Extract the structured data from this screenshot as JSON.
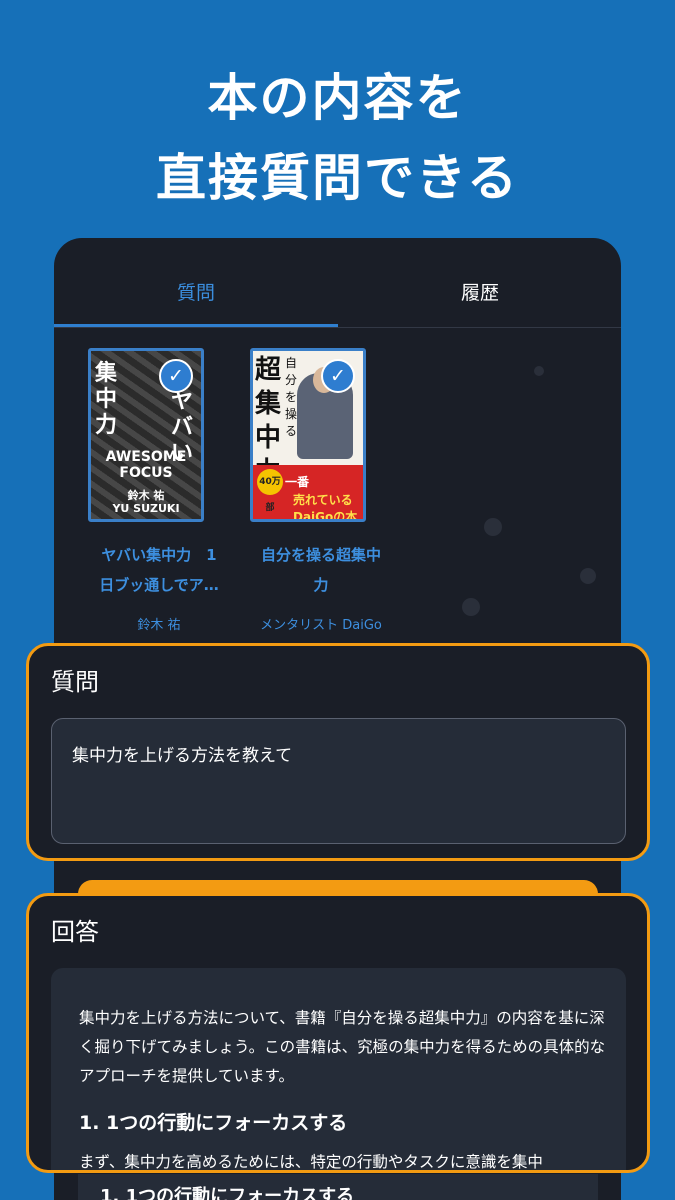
{
  "headline": {
    "line1": "本の内容を",
    "line2": "直接質問できる"
  },
  "tabs": {
    "question": "質問",
    "history": "履歴"
  },
  "books": [
    {
      "title_line1": "ヤバい集中力　1",
      "title_line2": "日ブッ通しでア…",
      "author": "鈴木 祐",
      "cover": {
        "kanji": "集中力",
        "kanji2": "ヤバい",
        "en_line1": "AWESOME",
        "en_line2": "FOCUS",
        "author_jp": "鈴木 祐",
        "author_en": "YU SUZUKI"
      }
    },
    {
      "title_line1": "自分を操る超集中",
      "title_line2": "力",
      "author": "メンタリスト DaiGo",
      "cover": {
        "big": "超集中力",
        "small": "自分を操る",
        "seal": "40万部",
        "band1": "一番",
        "band2": "売れている DaiGoの本"
      }
    }
  ],
  "question": {
    "label": "質問",
    "text": "集中力を上げる方法を教えて"
  },
  "answer": {
    "label": "回答",
    "body": "集中力を上げる方法について、書籍『自分を操る超集中力』の内容を基に深く掘り下げてみましょう。この書籍は、究極の集中力を得るための具体的なアプローチを提供しています。",
    "heading": "1. 1つの行動にフォーカスする",
    "para2": "まず、集中力を高めるためには、特定の行動やタスクに意識を集中"
  },
  "below_heading": "1. 1つの行動にフォーカスする",
  "colors": {
    "background": "#1670b8",
    "panel": "#1a1e27",
    "accent_orange": "#f39b12",
    "accent_blue": "#3b8ede"
  }
}
